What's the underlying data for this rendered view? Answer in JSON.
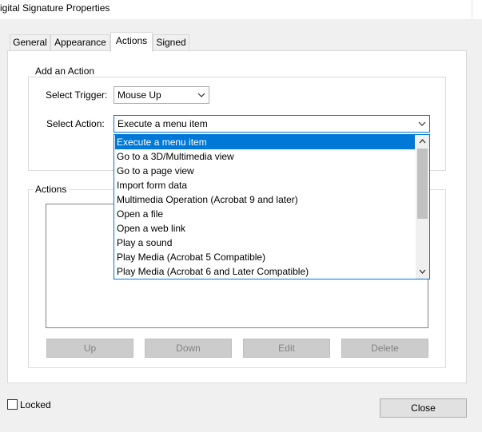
{
  "window": {
    "title": "igital Signature Properties"
  },
  "tabs": [
    {
      "label": "General"
    },
    {
      "label": "Appearance"
    },
    {
      "label": "Actions"
    },
    {
      "label": "Signed"
    }
  ],
  "add_action": {
    "group_label": "Add an Action",
    "trigger_label": "Select Trigger:",
    "trigger_value": "Mouse Up",
    "action_label": "Select Action:",
    "action_value": "Execute a menu item",
    "dropdown_items": [
      "Execute a menu item",
      "Go to a 3D/Multimedia view",
      "Go to a page view",
      "Import form data",
      "Multimedia Operation (Acrobat 9 and later)",
      "Open a file",
      "Open a web link",
      "Play a sound",
      "Play Media (Acrobat 5 Compatible)",
      "Play Media (Acrobat 6 and Later Compatible)"
    ],
    "selected_index": 0
  },
  "actions_group": {
    "label": "Actions",
    "buttons": {
      "up": "Up",
      "down": "Down",
      "edit": "Edit",
      "delete": "Delete"
    }
  },
  "footer": {
    "locked_label": "Locked",
    "close_label": "Close"
  },
  "colors": {
    "accent": "#0078d7",
    "disabled_button": "#cccccc",
    "panel": "#ffffff",
    "chrome": "#f0f0f0"
  }
}
